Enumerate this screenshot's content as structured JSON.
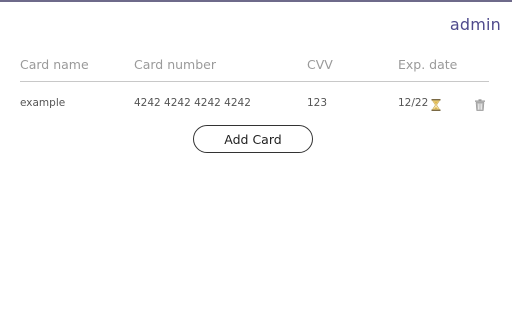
{
  "header": {
    "user_label": "admin"
  },
  "table": {
    "columns": [
      "Card name",
      "Card number",
      "CVV",
      "Exp. date"
    ],
    "rows": [
      {
        "name": "example",
        "number": "4242 4242 4242 4242",
        "cvv": "123",
        "exp": "12/22",
        "status_icon": "hourglass-icon",
        "action_icon": "trash-icon"
      }
    ]
  },
  "actions": {
    "add_card_label": "Add Card"
  },
  "colors": {
    "accent": "#4f4a8c",
    "hourglass": "#e0b84a",
    "trash": "#9a9a9a"
  }
}
